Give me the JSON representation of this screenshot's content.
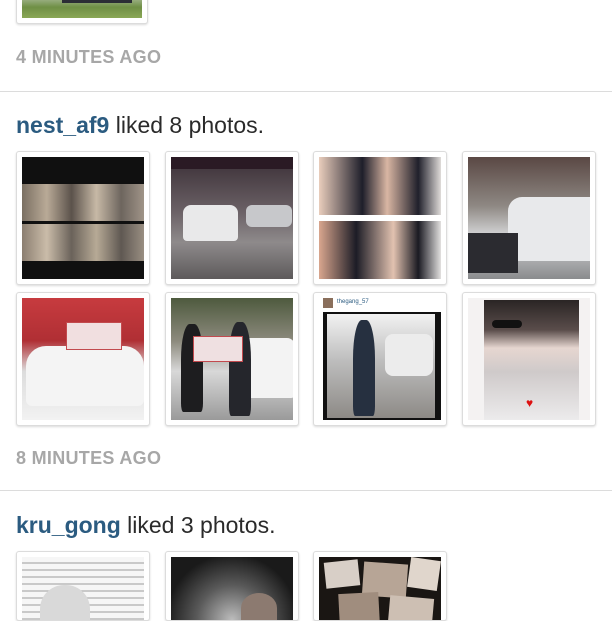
{
  "feed": {
    "top_timestamp": "4 MINUTES AGO",
    "items": [
      {
        "user": "nest_af9",
        "action": " liked 8 photos.",
        "timestamp": "8 MINUTES AGO",
        "photo_text": {
          "watermark": "thegang_57"
        }
      },
      {
        "user": "kru_gong",
        "action": " liked 3 photos."
      }
    ]
  },
  "colors": {
    "username": "#2b5b80",
    "timestamp": "#a7a7a7",
    "divider": "#dcdcdc",
    "text": "#2a2a2a"
  }
}
